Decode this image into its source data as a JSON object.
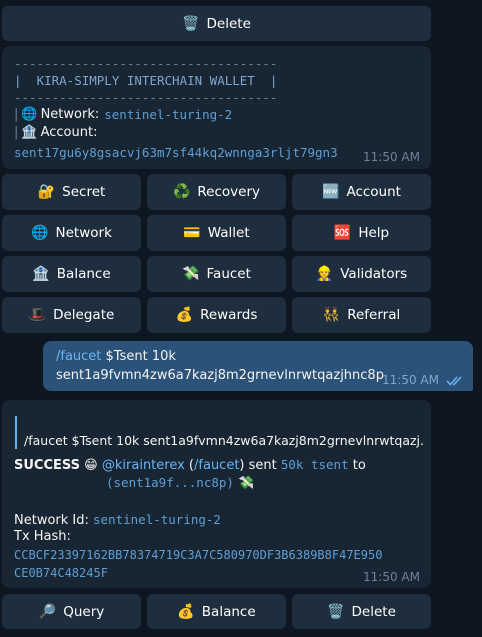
{
  "top_keyboard": {
    "delete_label": "Delete",
    "delete_icon": "wastebasket-icon"
  },
  "wallet_message": {
    "dashes": "-----------------------------------",
    "banner": "|  KIRA-SIMPLY INTERCHAIN WALLET  |",
    "network_prefix": "|",
    "network_label": "Network:",
    "network_value": "sentinel-turing-2",
    "account_prefix": "|",
    "account_label": "Account:",
    "account_value": "sent17gu6y8gsacvj63m7sf44kq2wnnga3rljt79gn3",
    "time": "11:50 AM"
  },
  "main_keyboard": {
    "rows": [
      [
        {
          "label": "Secret",
          "icon": "🔐"
        },
        {
          "label": "Recovery",
          "icon": "♻️"
        },
        {
          "label": "Account",
          "icon": "🆕"
        }
      ],
      [
        {
          "label": "Network",
          "icon": "🌐"
        },
        {
          "label": "Wallet",
          "icon": "💳"
        },
        {
          "label": "Help",
          "icon": "🆘"
        }
      ],
      [
        {
          "label": "Balance",
          "icon": "🏦"
        },
        {
          "label": "Faucet",
          "icon": "💸"
        },
        {
          "label": "Validators",
          "icon": "👷"
        }
      ],
      [
        {
          "label": "Delegate",
          "icon": "🎩"
        },
        {
          "label": "Rewards",
          "icon": "💰"
        },
        {
          "label": "Referral",
          "icon": "👯"
        }
      ]
    ]
  },
  "outgoing_message": {
    "command": "/faucet",
    "text_rest": " $Tsent 10k",
    "address": "sent1a9fvmn4zw6a7kazj8m2grnevlnrwtqazjhnc8p",
    "time": "11:50 AM",
    "status_icon": "double-check-icon"
  },
  "reply_message": {
    "quote": "/faucet $Tsent 10k sent1a9fvmn4zw6a7kazj8m2grnevlnrwtqazj...",
    "success": "SUCCESS",
    "success_emoji": "😁",
    "mention": "@kirainterex",
    "paren_open": " (",
    "cmd": "/faucet",
    "sent_text": ") sent ",
    "amount": "50k tsent",
    "to_text": " to",
    "addr_short": "(sent1a9f...nc8p)",
    "money_emoji": "💸",
    "network_id_label": "Network Id: ",
    "network_id_value": "sentinel-turing-2",
    "tx_hash_label": "Tx Hash:",
    "tx_hash_line1": "CCBCF23397162BB78374719C3A7C580970DF3B6389B8F47E950",
    "tx_hash_line2": "CE0B74C48245F",
    "time": "11:50 AM"
  },
  "bottom_keyboard": {
    "query_label": "Query",
    "query_icon": "🔎",
    "balance_label": "Balance",
    "balance_icon": "💰",
    "delete_label": "Delete",
    "delete_icon": "🗑️"
  },
  "colors": {
    "background": "#0e1621",
    "bubble_in": "#182533",
    "bubble_out": "#2b5278",
    "button": "#1f2e3e",
    "link": "#6ab3f3",
    "code": "#5e9fd6"
  }
}
